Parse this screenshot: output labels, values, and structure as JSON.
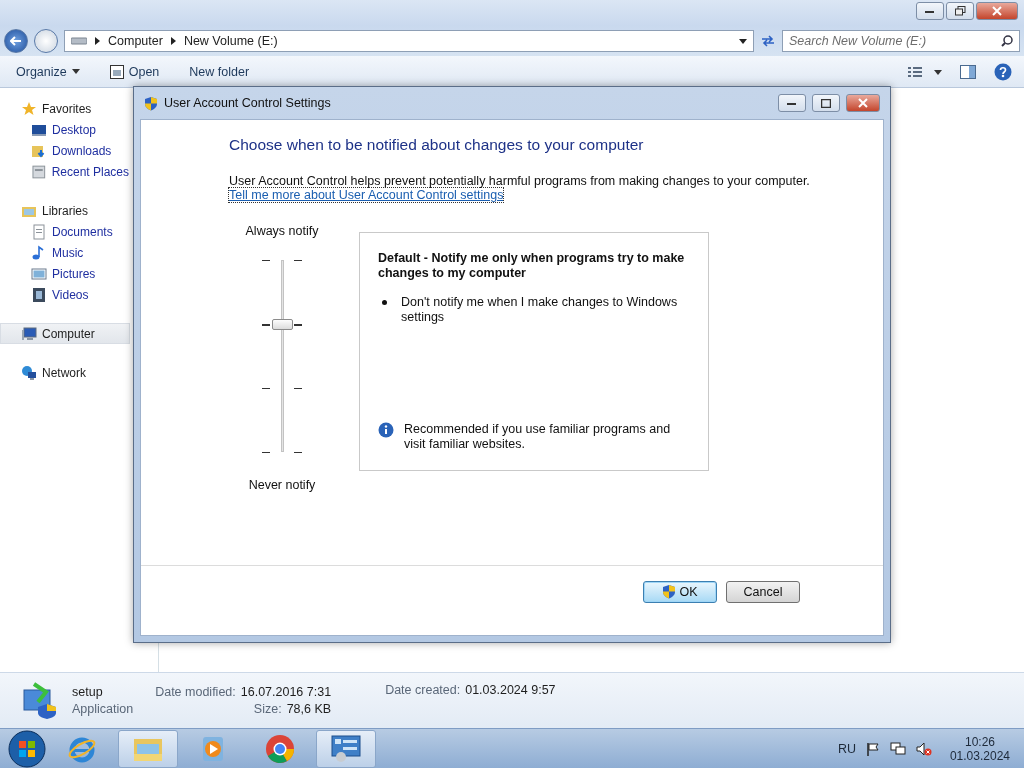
{
  "explorer": {
    "breadcrumb": [
      "Computer",
      "New Volume (E:)"
    ],
    "search": {
      "placeholder": "Search New Volume (E:)"
    },
    "toolbar": [
      {
        "kind": "menu",
        "label": "Organize"
      },
      {
        "kind": "open",
        "label": "Open"
      },
      {
        "kind": "plain",
        "label": "New folder"
      }
    ],
    "nav": [
      {
        "kind": "star",
        "label": "Favorites",
        "selected": false,
        "children": [
          {
            "kind": "desktop",
            "label": "Desktop",
            "selected": false
          },
          {
            "kind": "downloads",
            "label": "Downloads",
            "selected": false
          },
          {
            "kind": "recent",
            "label": "Recent Places",
            "selected": false
          }
        ]
      },
      {
        "kind": "libraries",
        "label": "Libraries",
        "selected": false,
        "children": [
          {
            "kind": "documents",
            "label": "Documents",
            "selected": false
          },
          {
            "kind": "music",
            "label": "Music",
            "selected": false
          },
          {
            "kind": "pictures",
            "label": "Pictures",
            "selected": false
          },
          {
            "kind": "videos",
            "label": "Videos",
            "selected": false
          }
        ]
      },
      {
        "kind": "computer",
        "label": "Computer",
        "selected": true
      },
      {
        "kind": "network",
        "label": "Network",
        "selected": false
      }
    ],
    "details": {
      "name": "setup",
      "type": "Application",
      "fields": [
        {
          "label": "Date modified:",
          "value": "16.07.2016 7:31"
        },
        {
          "label": "Size:",
          "value": "78,6 KB"
        },
        {
          "label": "Date created:",
          "value": "01.03.2024 9:57"
        }
      ]
    }
  },
  "dialog": {
    "title": "User Account Control Settings",
    "heading": "Choose when to be notified about changes to your computer",
    "description": "User Account Control helps prevent potentially harmful programs from making changes to your computer.",
    "link": "Tell me more about User Account Control settings",
    "slider": {
      "top_label": "Always notify",
      "bottom_label": "Never notify",
      "level": 0.667
    },
    "info": {
      "title": "Default - Notify me only when programs try to make changes to my computer",
      "bullets": [
        "Don't notify me when I make changes to Windows settings"
      ],
      "note": "Recommended if you use familiar programs and visit familiar websites."
    },
    "buttons": [
      {
        "label": "OK",
        "default": true
      },
      {
        "label": "Cancel",
        "default": false
      }
    ]
  },
  "taskbar": {
    "apps": [
      {
        "kind": "ie",
        "active": false
      },
      {
        "kind": "explorer",
        "active": true
      },
      {
        "kind": "media",
        "active": false
      },
      {
        "kind": "chrome",
        "active": false
      },
      {
        "kind": "control",
        "active": true
      }
    ],
    "language": "RU",
    "time": "10:26",
    "date": "01.03.2024"
  }
}
